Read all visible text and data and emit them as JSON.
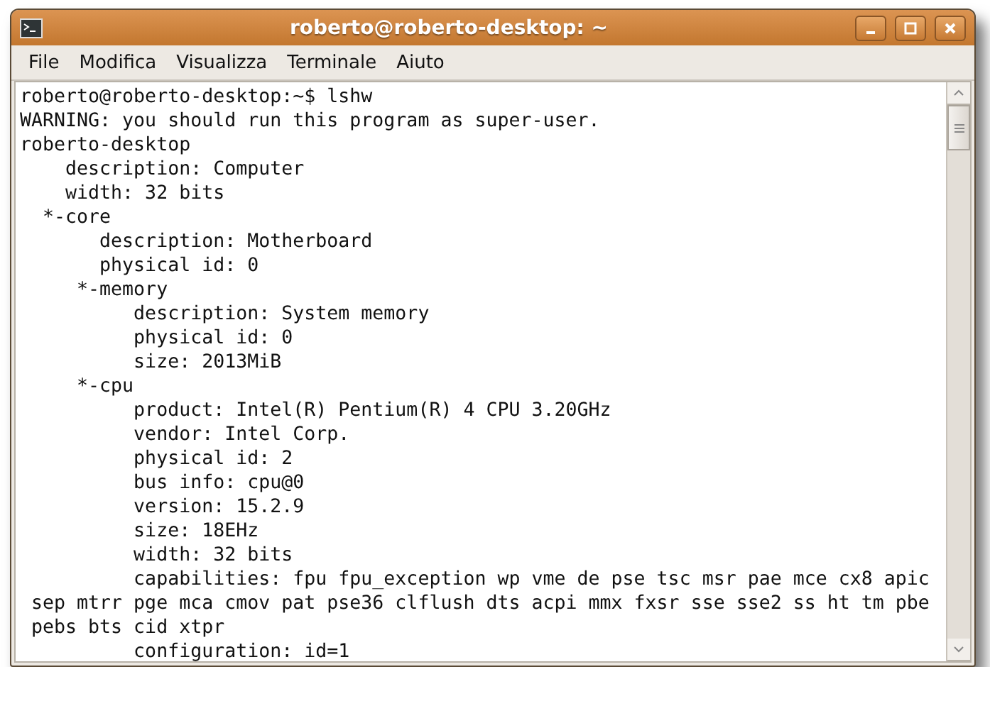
{
  "window": {
    "title": "roberto@roberto-desktop: ~"
  },
  "menu": [
    {
      "label": "File"
    },
    {
      "label": "Modifica"
    },
    {
      "label": "Visualizza"
    },
    {
      "label": "Terminale"
    },
    {
      "label": "Aiuto"
    }
  ],
  "terminal": {
    "lines": [
      "roberto@roberto-desktop:~$ lshw",
      "WARNING: you should run this program as super-user.",
      "roberto-desktop",
      "    description: Computer",
      "    width: 32 bits",
      "  *-core",
      "       description: Motherboard",
      "       physical id: 0",
      "     *-memory",
      "          description: System memory",
      "          physical id: 0",
      "          size: 2013MiB",
      "     *-cpu",
      "          product: Intel(R) Pentium(R) 4 CPU 3.20GHz",
      "          vendor: Intel Corp.",
      "          physical id: 2",
      "          bus info: cpu@0",
      "          version: 15.2.9",
      "          size: 18EHz",
      "          width: 32 bits",
      "          capabilities: fpu fpu_exception wp vme de pse tsc msr pae mce cx8 apic",
      " sep mtrr pge mca cmov pat pse36 clflush dts acpi mmx fxsr sse sse2 ss ht tm pbe",
      " pebs bts cid xtpr",
      "          configuration: id=1"
    ]
  }
}
